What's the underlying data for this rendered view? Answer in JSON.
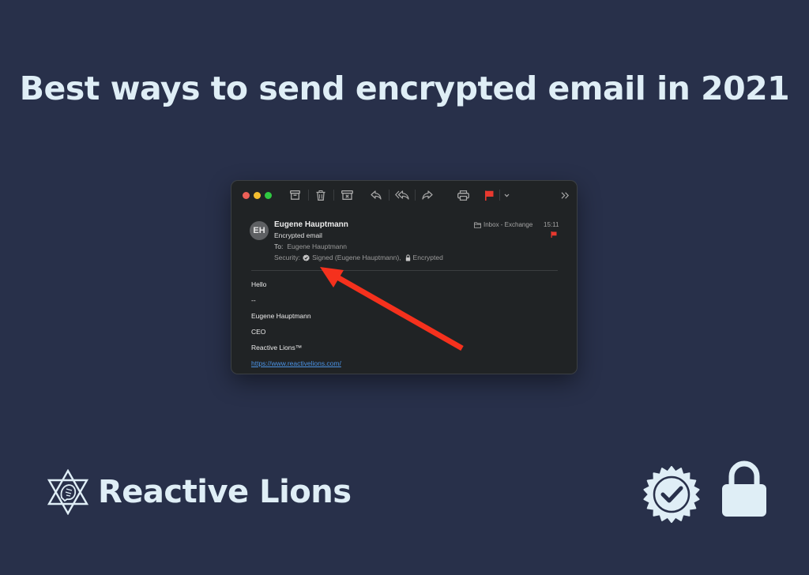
{
  "headline": "Best ways to send encrypted email in 2021",
  "window": {
    "toolbar": {
      "buttons": [
        {
          "name": "archive",
          "icon": "archive-icon"
        },
        {
          "name": "delete",
          "icon": "trash-icon"
        },
        {
          "name": "junk",
          "icon": "junk-icon"
        },
        {
          "name": "reply",
          "icon": "reply-icon"
        },
        {
          "name": "reply-all",
          "icon": "reply-all-icon"
        },
        {
          "name": "forward",
          "icon": "forward-icon"
        },
        {
          "name": "print",
          "icon": "printer-icon"
        },
        {
          "name": "flag",
          "icon": "flag-icon"
        },
        {
          "name": "flag-menu",
          "icon": "chevron-down-icon"
        },
        {
          "name": "more",
          "icon": "chevron-double-right-icon"
        }
      ],
      "colors": {
        "close": "#ec5f57",
        "minimize": "#f2bd2f",
        "zoom": "#2fc841",
        "flag": "#e8392f"
      }
    },
    "message": {
      "avatar_initials": "EH",
      "from": "Eugene Hauptmann",
      "subject": "Encrypted email",
      "to_label": "To:",
      "to_value": "Eugene Hauptmann",
      "security_label": "Security:",
      "signed_text": "Signed (Eugene Hauptmann),",
      "encrypted_text": "Encrypted",
      "mailbox": "Inbox - Exchange",
      "time": "15:11"
    },
    "body": {
      "lines": [
        "Hello",
        "--",
        "Eugene Hauptmann",
        "CEO",
        "Reactive Lions™"
      ],
      "link": "https://www.reactivelions.com/",
      "link_color": "#4b93e5"
    }
  },
  "annotation": {
    "type": "arrow",
    "color": "#f5311d",
    "points_to": "security-signed"
  },
  "brand": {
    "name": "Reactive Lions",
    "logo": "star-of-david-lion-icon"
  },
  "footer_icons": [
    "verified-badge-icon",
    "lock-icon"
  ],
  "colors": {
    "background": "#28304a",
    "text_light": "#dfeef6"
  }
}
